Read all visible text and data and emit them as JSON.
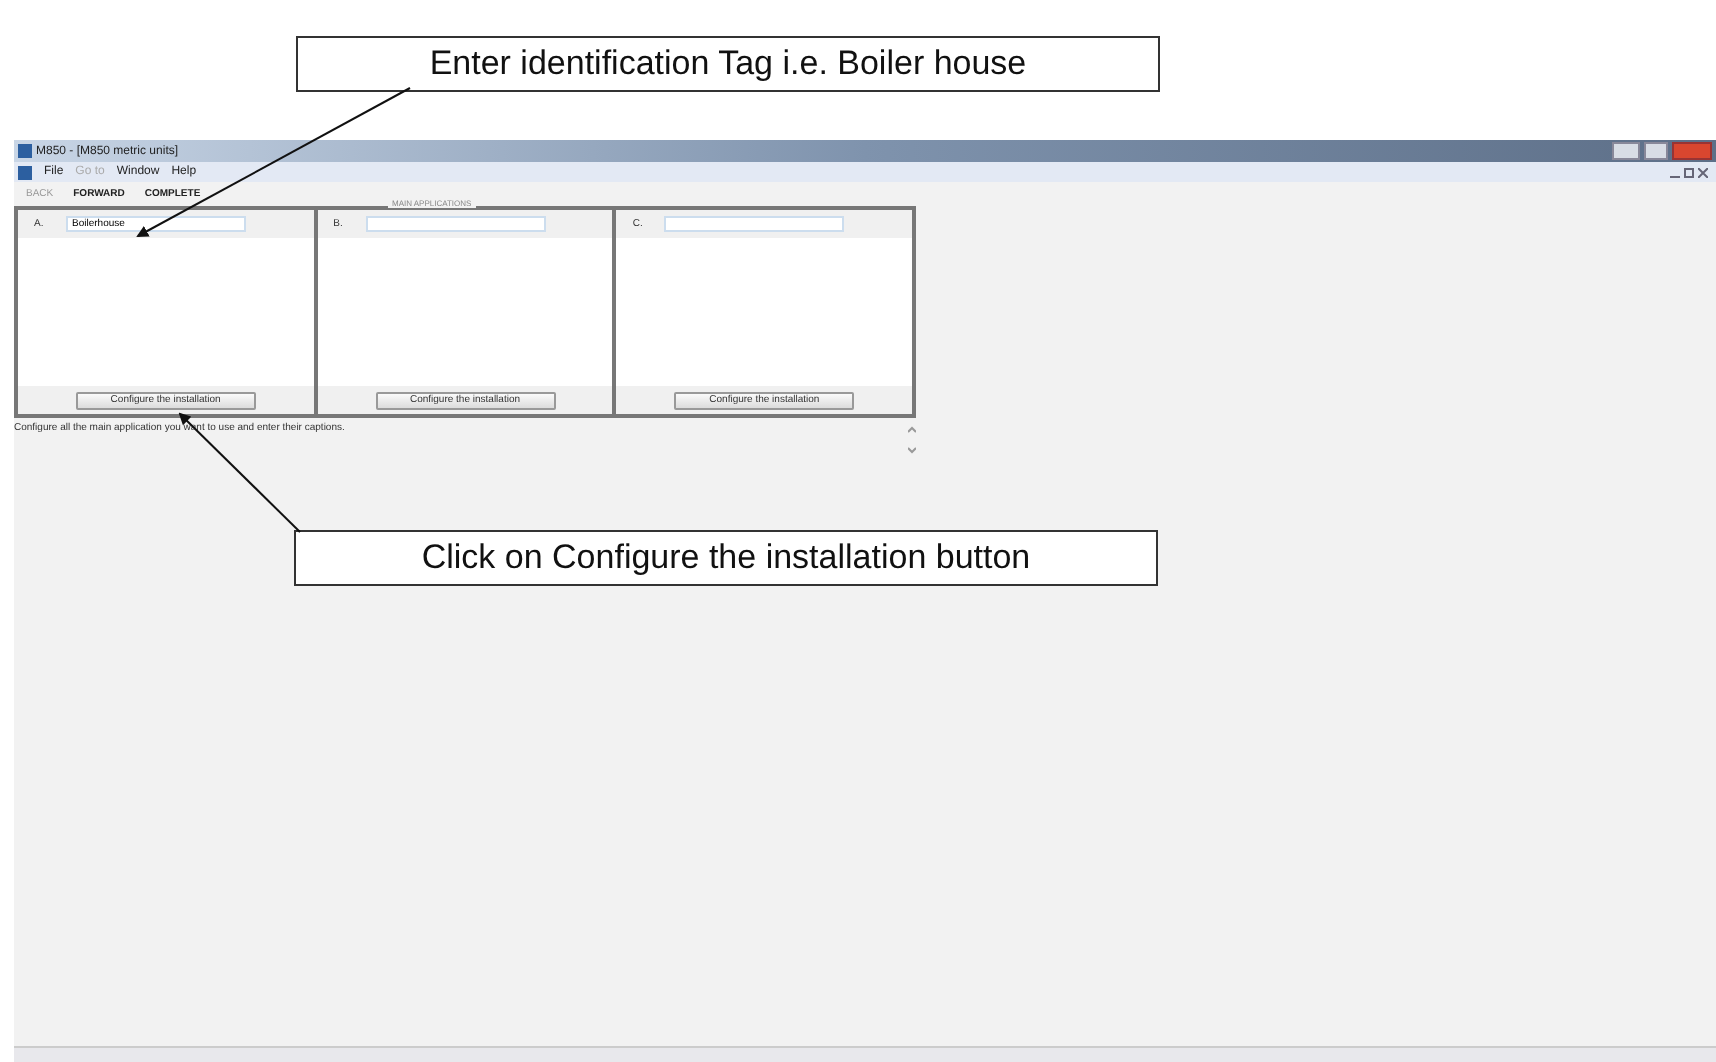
{
  "callouts": [
    {
      "text": "Enter identification Tag i.e. Boiler house"
    },
    {
      "text": "Click on Configure the installation button"
    }
  ],
  "window": {
    "title": "M850 - [M850 metric units]"
  },
  "menu": [
    {
      "label": "File",
      "disabled": false
    },
    {
      "label": "Go to",
      "disabled": true
    },
    {
      "label": "Window",
      "disabled": false
    },
    {
      "label": "Help",
      "disabled": false
    }
  ],
  "toolbar": [
    {
      "label": "BACK",
      "disabled": true
    },
    {
      "label": "FORWARD",
      "disabled": false
    },
    {
      "label": "COMPLETE",
      "disabled": false
    }
  ],
  "group_title": "MAIN APPLICATIONS",
  "applications": [
    {
      "letter": "A.",
      "value": "Boilerhouse",
      "button": "Configure the installation"
    },
    {
      "letter": "B.",
      "button": "Configure the installation"
    },
    {
      "letter": "C.",
      "button": "Configure the installation"
    }
  ],
  "hint": "Configure all the main application you want to use and enter their captions."
}
